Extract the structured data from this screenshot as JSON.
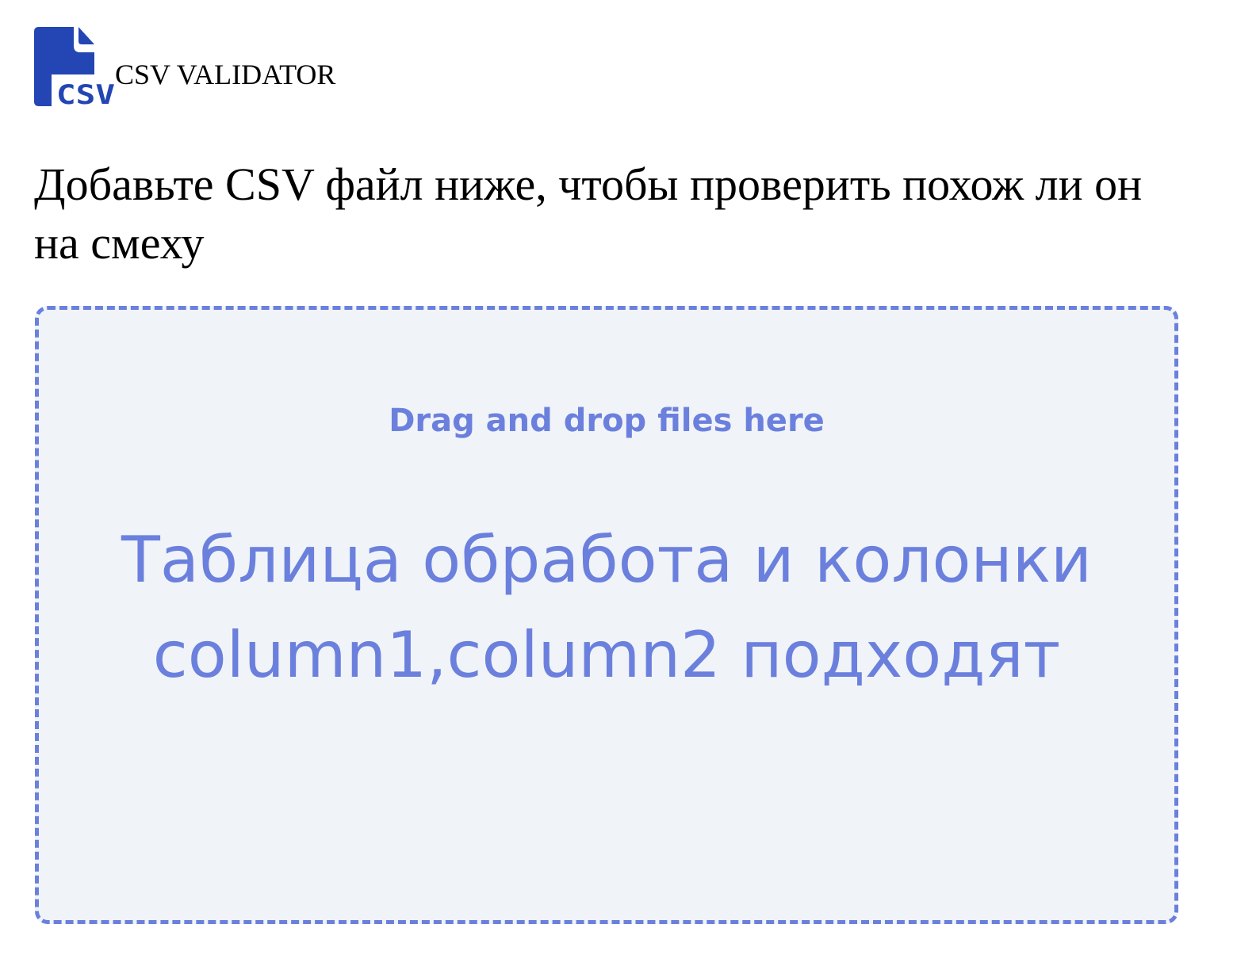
{
  "header": {
    "logo_icon": "csv-file-icon",
    "logo_text": "CSV",
    "title": "CSV VALIDATOR"
  },
  "instructions": "Добавьте CSV файл ниже, чтобы проверить похож ли он на смеху",
  "dropzone": {
    "hint": "Drag and drop files here",
    "result_message": "Таблица обработа и колонки column1,column2 подходят"
  },
  "colors": {
    "brand": "#2346b4",
    "accent": "#6b80dd",
    "dropzone_background": "#f0f3f8"
  }
}
